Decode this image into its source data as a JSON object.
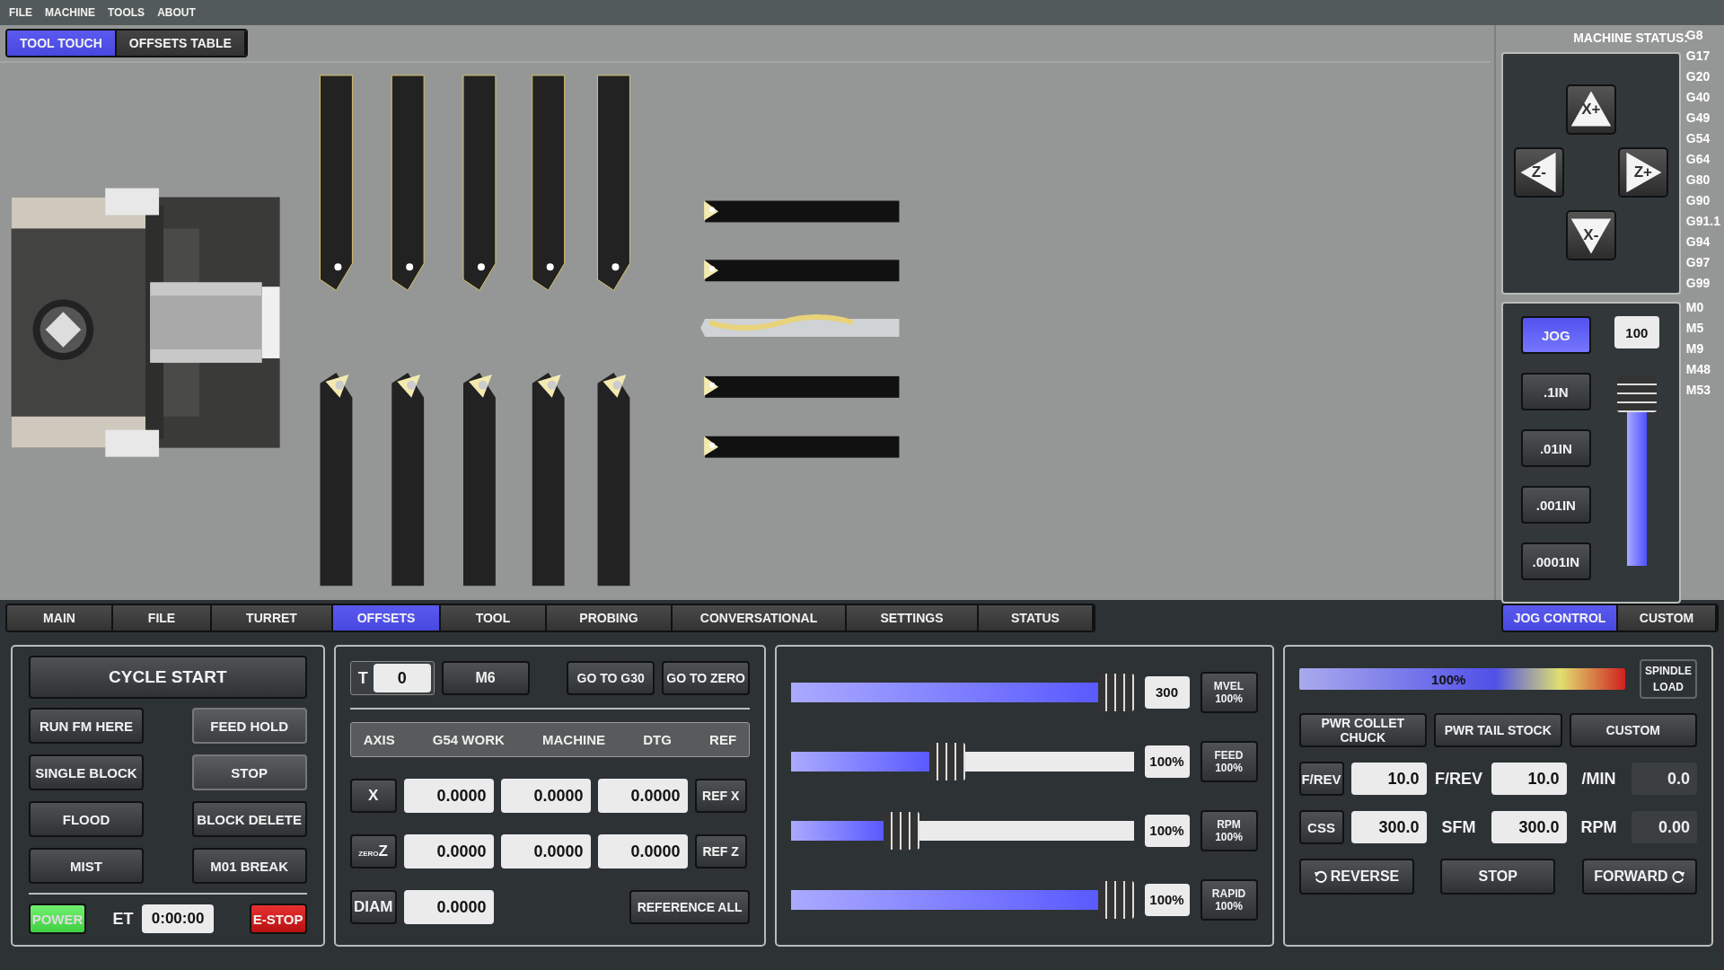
{
  "menu": [
    "FILE",
    "MACHINE",
    "TOOLS",
    "ABOUT"
  ],
  "view_tabs": [
    {
      "label": "TOOL TOUCH",
      "selected": true
    },
    {
      "label": "OFFSETS TABLE",
      "selected": false
    }
  ],
  "machine_status": {
    "label": "MACHINE STATUS:",
    "g_codes": [
      "G8",
      "G17",
      "G20",
      "G40",
      "G49",
      "G54",
      "G64",
      "G80",
      "G90",
      "G91.1",
      "G94",
      "G97",
      "G99"
    ],
    "m_codes": [
      "M0",
      "M5",
      "M9",
      "M48",
      "M53"
    ]
  },
  "jog_buttons": [
    "X+",
    "Z-",
    "Z+",
    "X-"
  ],
  "jog_increments": [
    {
      "label": "JOG",
      "selected": true
    },
    {
      "label": ".1IN",
      "selected": false
    },
    {
      "label": ".01IN",
      "selected": false
    },
    {
      "label": ".001IN",
      "selected": false
    },
    {
      "label": ".0001IN",
      "selected": false
    }
  ],
  "jog_rate": {
    "value": "100",
    "level": 0.9
  },
  "main_tabs": [
    {
      "label": "MAIN",
      "selected": false
    },
    {
      "label": "FILE",
      "selected": false
    },
    {
      "label": "TURRET",
      "selected": false
    },
    {
      "label": "OFFSETS",
      "selected": true
    },
    {
      "label": "TOOL",
      "selected": false
    },
    {
      "label": "PROBING",
      "selected": false
    },
    {
      "label": "CONVERSATIONAL",
      "selected": false
    },
    {
      "label": "SETTINGS",
      "selected": false
    },
    {
      "label": "STATUS",
      "selected": false
    }
  ],
  "side_tabs": [
    {
      "label": "JOG CONTROL",
      "selected": true
    },
    {
      "label": "CUSTOM",
      "selected": false
    }
  ],
  "cycle_panel": {
    "cycle_start": "CYCLE START",
    "buttons": [
      {
        "label": "RUN FM HERE",
        "lit": false
      },
      {
        "label": "FEED HOLD",
        "lit": true
      },
      {
        "label": "SINGLE BLOCK",
        "lit": false
      },
      {
        "label": "STOP",
        "lit": true
      },
      {
        "label": "FLOOD",
        "lit": false
      },
      {
        "label": "BLOCK DELETE",
        "lit": false
      },
      {
        "label": "MIST",
        "lit": false
      },
      {
        "label": "M01 BREAK",
        "lit": false
      }
    ],
    "power": {
      "label": "POWER",
      "on": true
    },
    "et_label": "ET",
    "et_value": "0:00:00",
    "estop": "E-STOP"
  },
  "offsets_panel": {
    "tool_label": "T",
    "tool_value": "0",
    "m6": "M6",
    "go_g30": "GO TO G30",
    "go_zero": "GO TO ZERO",
    "columns": [
      "AXIS",
      "G54 WORK",
      "MACHINE",
      "DTG",
      "REF"
    ],
    "rows": [
      {
        "axis": "X",
        "prefix": "",
        "values": [
          "0.0000",
          "0.0000",
          "0.0000"
        ],
        "ref": "REF X"
      },
      {
        "axis": "Z",
        "prefix": "ZERO",
        "values": [
          "0.0000",
          "0.0000",
          "0.0000"
        ],
        "ref": "REF Z"
      }
    ],
    "diam_label": "DIAM",
    "diam_value": "0.0000",
    "reference_all": "REFERENCE ALL"
  },
  "overrides": [
    {
      "value": "300",
      "label": "MVEL",
      "percent": "100%",
      "level": 1.0
    },
    {
      "value": "100%",
      "label": "FEED",
      "percent": "100%",
      "level": 0.45
    },
    {
      "value": "100%",
      "label": "RPM",
      "percent": "100%",
      "level": 0.3
    },
    {
      "value": "100%",
      "label": "RAPID",
      "percent": "100%",
      "level": 1.0
    }
  ],
  "spindle": {
    "load_reading": "100%",
    "load_label": "SPINDLE LOAD",
    "buttons": [
      "PWR COLLET CHUCK",
      "PWR TAIL STOCK",
      "CUSTOM"
    ],
    "rows": [
      {
        "mode": "F/REV",
        "value": "10.0",
        "unit": "F/REV",
        "value2": "10.0",
        "unit2": "/MIN",
        "readout": "0.0"
      },
      {
        "mode": "CSS",
        "value": "300.0",
        "unit": "SFM",
        "value2": "300.0",
        "unit2": "RPM",
        "readout": "0.00"
      }
    ],
    "direction_buttons": [
      "REVERSE",
      "STOP",
      "FORWARD"
    ]
  }
}
